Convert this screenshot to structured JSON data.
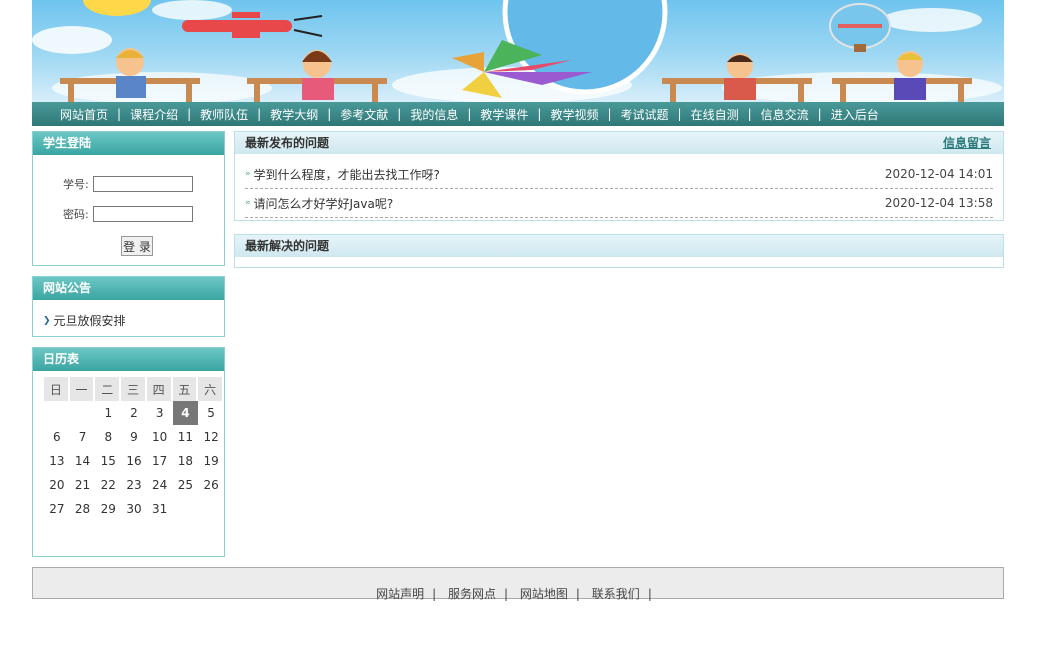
{
  "nav": {
    "items": [
      "网站首页",
      "课程介绍",
      "教师队伍",
      "教学大纲",
      "参考文献",
      "我的信息",
      "教学课件",
      "教学视频",
      "考试试题",
      "在线自测",
      "信息交流",
      "进入后台"
    ],
    "separator": "|"
  },
  "login": {
    "title": "学生登陆",
    "student_id_label": "学号:",
    "password_label": "密码:",
    "student_id_value": "",
    "password_value": "",
    "submit_label": "登 录"
  },
  "notice": {
    "title": "网站公告",
    "items": [
      "元旦放假安排"
    ]
  },
  "calendar": {
    "title": "日历表",
    "weekdays": [
      "日",
      "一",
      "二",
      "三",
      "四",
      "五",
      "六"
    ],
    "weeks": [
      [
        "",
        "",
        "1",
        "2",
        "3",
        "4",
        "5"
      ],
      [
        "6",
        "7",
        "8",
        "9",
        "10",
        "11",
        "12"
      ],
      [
        "13",
        "14",
        "15",
        "16",
        "17",
        "18",
        "19"
      ],
      [
        "20",
        "21",
        "22",
        "23",
        "24",
        "25",
        "26"
      ],
      [
        "27",
        "28",
        "29",
        "30",
        "31",
        "",
        ""
      ]
    ],
    "today": "4"
  },
  "latest_questions": {
    "title": "最新发布的问题",
    "more_label": "信息留言",
    "rows": [
      {
        "text": "学到什么程度，才能出去找工作呀?",
        "date": "2020-12-04 14:01"
      },
      {
        "text": "请问怎么才好学好Java呢?",
        "date": "2020-12-04 13:58"
      }
    ]
  },
  "solved_questions": {
    "title": "最新解决的问题"
  },
  "footer": {
    "links": [
      "网站声明",
      "服务网点",
      "网站地图",
      "联系我们"
    ],
    "separator": "|"
  },
  "colors": {
    "nav_bg": "#2f7777",
    "box_header": "#3aa5a2",
    "box_border": "#8ccfd0",
    "today_bg": "#777777"
  }
}
